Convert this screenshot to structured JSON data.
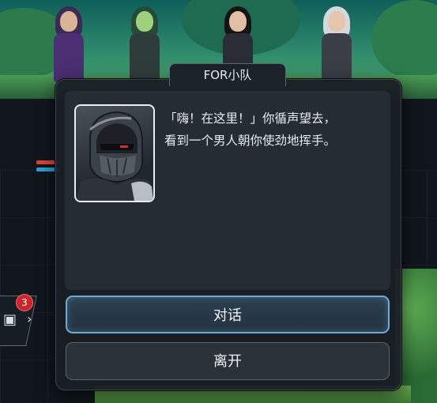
{
  "side_tab": {
    "badge_count": "3"
  },
  "dialog": {
    "title": "FOR小队",
    "story_lines": [
      "「嗨！在这里！」你循声望去，",
      "看到一个男人朝你使劲地挥手。"
    ],
    "buttons": {
      "talk": "对话",
      "leave": "离开"
    }
  },
  "colors": {
    "accent_border": "#6fa9d6",
    "badge": "#c8252c"
  }
}
